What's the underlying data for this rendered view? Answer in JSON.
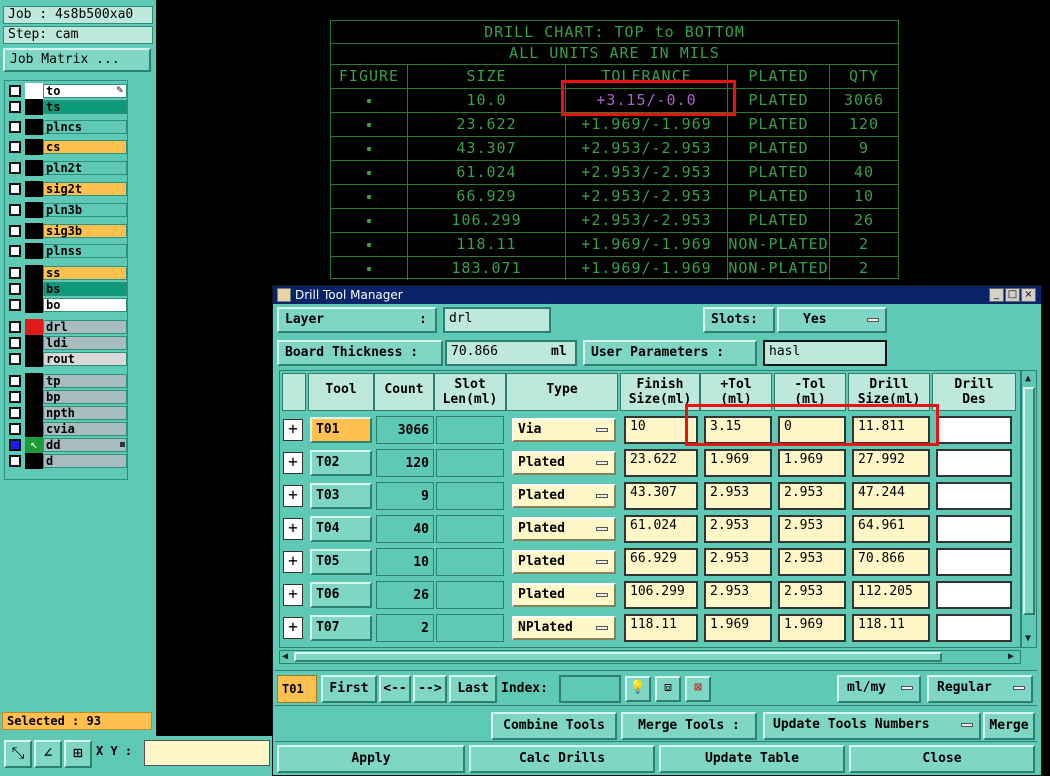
{
  "job": {
    "label": "Job : 4s8b500xa0",
    "step": "Step: cam",
    "matrix_button": "Job Matrix ..."
  },
  "layers": [
    {
      "name": "to",
      "color": "#ffffff",
      "name_bg": "#ffffff",
      "selected": false,
      "icon": "pencil-icon"
    },
    {
      "name": "ts",
      "color": "#000000",
      "name_bg": "#0e9a7a",
      "selected": false
    },
    {
      "name": "plncs",
      "color": "#000000",
      "name_bg": "#5ec9b4",
      "selected": false
    },
    {
      "name": "cs",
      "color": "#000000",
      "name_bg": "#ffc04d",
      "selected": false
    },
    {
      "name": "pln2t",
      "color": "#000000",
      "name_bg": "#5ec9b4",
      "selected": false
    },
    {
      "name": "sig2t",
      "color": "#000000",
      "name_bg": "#ffc04d",
      "selected": false
    },
    {
      "name": "pln3b",
      "color": "#000000",
      "name_bg": "#5ec9b4",
      "selected": false
    },
    {
      "name": "sig3b",
      "color": "#000000",
      "name_bg": "#ffc04d",
      "selected": false
    },
    {
      "name": "plnss",
      "color": "#000000",
      "name_bg": "#5ec9b4",
      "selected": false
    },
    {
      "name": "ss",
      "color": "#000000",
      "name_bg": "#ffc04d",
      "selected": false
    },
    {
      "name": "bs",
      "color": "#000000",
      "name_bg": "#0e9a7a",
      "selected": false
    },
    {
      "name": "bo",
      "color": "#000000",
      "name_bg": "#ffffff",
      "selected": false
    },
    {
      "name": "drl",
      "color": "#e11b1b",
      "name_bg": "#a8bcc0",
      "selected": false
    },
    {
      "name": "ldi",
      "color": "#000000",
      "name_bg": "#a8bcc0",
      "selected": false
    },
    {
      "name": "rout",
      "color": "#000000",
      "name_bg": "#d8d8d8",
      "selected": false
    },
    {
      "name": "tp",
      "color": "#000000",
      "name_bg": "#a8bcc0",
      "selected": false
    },
    {
      "name": "bp",
      "color": "#000000",
      "name_bg": "#a8bcc0",
      "selected": false
    },
    {
      "name": "npth",
      "color": "#000000",
      "name_bg": "#a8bcc0",
      "selected": false
    },
    {
      "name": "cvia",
      "color": "#000000",
      "name_bg": "#a8bcc0",
      "selected": false
    },
    {
      "name": "dd",
      "color": "#000000",
      "name_bg": "#a8bcc0",
      "selected": true,
      "icon": "cursor-arrow-icon"
    },
    {
      "name": "d",
      "color": "#000000",
      "name_bg": "#a8bcc0",
      "selected": false
    }
  ],
  "selected_status": "Selected : 93",
  "xy_label": "X Y :",
  "drill_chart": {
    "title": "DRILL CHART: TOP to BOTTOM",
    "subtitle": "ALL UNITS ARE IN MILS",
    "headers": [
      "FIGURE",
      "SIZE",
      "TOLERANCE",
      "PLATED",
      "QTY"
    ],
    "rows": [
      {
        "size": "10.0",
        "tolerance": "+3.15/-0.0",
        "plated": "PLATED",
        "qty": "3066",
        "tol_color": "#b060d0"
      },
      {
        "size": "23.622",
        "tolerance": "+1.969/-1.969",
        "plated": "PLATED",
        "qty": "120"
      },
      {
        "size": "43.307",
        "tolerance": "+2.953/-2.953",
        "plated": "PLATED",
        "qty": "9"
      },
      {
        "size": "61.024",
        "tolerance": "+2.953/-2.953",
        "plated": "PLATED",
        "qty": "40"
      },
      {
        "size": "66.929",
        "tolerance": "+2.953/-2.953",
        "plated": "PLATED",
        "qty": "10"
      },
      {
        "size": "106.299",
        "tolerance": "+2.953/-2.953",
        "plated": "PLATED",
        "qty": "26"
      },
      {
        "size": "118.11",
        "tolerance": "+1.969/-1.969",
        "plated": "NON-PLATED",
        "qty": "2"
      },
      {
        "size": "183.071",
        "tolerance": "+1.969/-1.969",
        "plated": "NON-PLATED",
        "qty": "2"
      }
    ]
  },
  "dialog": {
    "title": "Drill Tool Manager",
    "layer_label": "Layer",
    "layer_colon": ":",
    "layer_value": "drl",
    "slots_label": "Slots:",
    "slots_value": "Yes",
    "board_thickness_label": "Board Thickness :",
    "board_thickness_value": "70.866",
    "board_thickness_unit": "ml",
    "user_params_label": "User Parameters :",
    "user_params_value": "hasl",
    "columns": [
      "Tool",
      "Count",
      "Slot Len(ml)",
      "Type",
      "Finish Size(ml)",
      "+Tol (ml)",
      "-Tol (ml)",
      "Drill Size(ml)",
      "Drill Des"
    ],
    "columns_split": [
      [
        "Tool"
      ],
      [
        "Count"
      ],
      [
        "Slot",
        "Len(ml)"
      ],
      [
        "Type"
      ],
      [
        "Finish",
        "Size(ml)"
      ],
      [
        "+Tol",
        "(ml)"
      ],
      [
        "-Tol",
        "(ml)"
      ],
      [
        "Drill",
        "Size(ml)"
      ],
      [
        "Drill",
        "Des"
      ]
    ],
    "tools": [
      {
        "tool": "T01",
        "count": "3066",
        "type": "Via",
        "finish": "10",
        "ptol": "3.15",
        "mtol": "0",
        "drill": "11.811",
        "active": true
      },
      {
        "tool": "T02",
        "count": "120",
        "type": "Plated",
        "finish": "23.622",
        "ptol": "1.969",
        "mtol": "1.969",
        "drill": "27.992"
      },
      {
        "tool": "T03",
        "count": "9",
        "type": "Plated",
        "finish": "43.307",
        "ptol": "2.953",
        "mtol": "2.953",
        "drill": "47.244"
      },
      {
        "tool": "T04",
        "count": "40",
        "type": "Plated",
        "finish": "61.024",
        "ptol": "2.953",
        "mtol": "2.953",
        "drill": "64.961"
      },
      {
        "tool": "T05",
        "count": "10",
        "type": "Plated",
        "finish": "66.929",
        "ptol": "2.953",
        "mtol": "2.953",
        "drill": "70.866"
      },
      {
        "tool": "T06",
        "count": "26",
        "type": "Plated",
        "finish": "106.299",
        "ptol": "2.953",
        "mtol": "2.953",
        "drill": "112.205"
      },
      {
        "tool": "T07",
        "count": "2",
        "type": "NPlated",
        "finish": "118.11",
        "ptol": "1.969",
        "mtol": "1.969",
        "drill": "118.11"
      }
    ],
    "nav": {
      "current_tool": "T01",
      "first": "First",
      "prev": "<--",
      "next": "-->",
      "last": "Last",
      "index_label": "Index:",
      "units_value": "ml/my",
      "mode_value": "Regular"
    },
    "combine_tools": "Combine Tools",
    "merge_tools_label": "Merge Tools :",
    "update_tools_numbers": "Update Tools Numbers",
    "merge": "Merge",
    "apply": "Apply",
    "calc_drills": "Calc Drills",
    "update_table": "Update Table",
    "close": "Close"
  }
}
